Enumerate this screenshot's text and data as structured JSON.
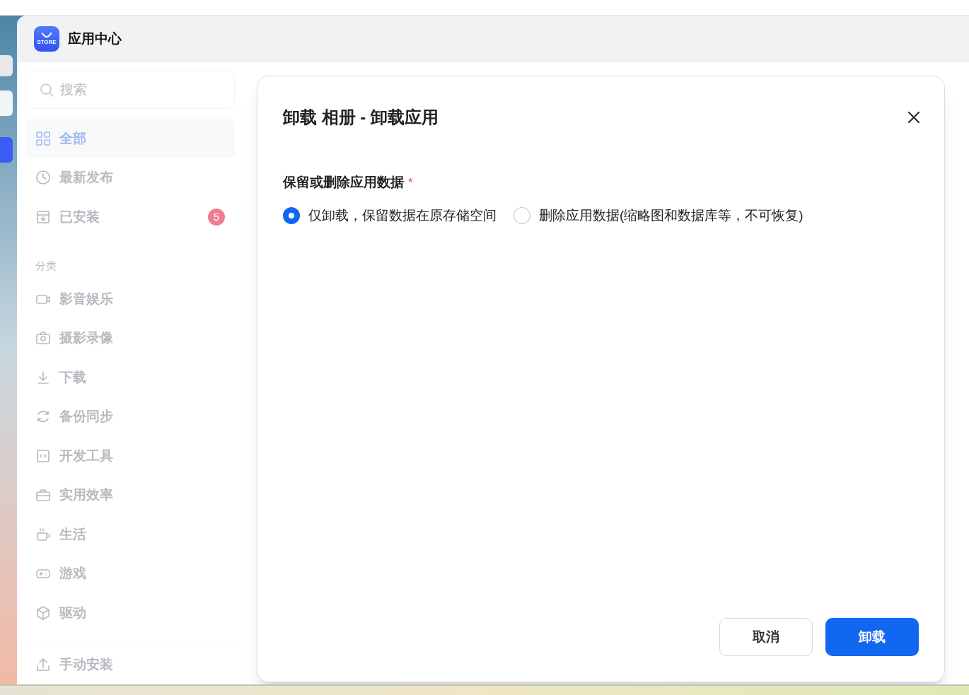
{
  "app": {
    "title": "应用中心",
    "logo_text": "STORE"
  },
  "sidebar": {
    "search_placeholder": "搜索",
    "items": [
      {
        "label": "全部",
        "selected": true
      },
      {
        "label": "最新发布",
        "selected": false
      },
      {
        "label": "已安装",
        "selected": false,
        "badge": "5"
      }
    ],
    "category_heading": "分类",
    "categories": [
      {
        "label": "影音娱乐"
      },
      {
        "label": "摄影录像"
      },
      {
        "label": "下载"
      },
      {
        "label": "备份同步"
      },
      {
        "label": "开发工具"
      },
      {
        "label": "实用效率"
      },
      {
        "label": "生活"
      },
      {
        "label": "游戏"
      },
      {
        "label": "驱动"
      }
    ],
    "footer_item": "手动安装"
  },
  "dialog": {
    "title": "卸载 相册 - 卸载应用",
    "field_label": "保留或删除应用数据",
    "required_mark": "*",
    "options": [
      {
        "label": "仅卸载，保留数据在原存储空间",
        "selected": true
      },
      {
        "label": "删除应用数据(缩略图和数据库等，不可恢复)",
        "selected": false
      }
    ],
    "buttons": [
      {
        "label": "取消",
        "kind": "secondary"
      },
      {
        "label": "卸载",
        "kind": "primary"
      }
    ]
  }
}
